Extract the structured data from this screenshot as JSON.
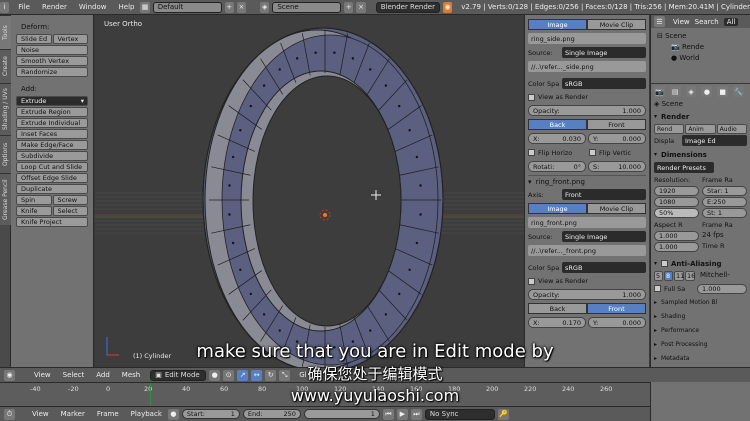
{
  "topbar": {
    "menus": [
      "File",
      "Render",
      "Window",
      "Help"
    ],
    "layout": "Default",
    "scene": "Scene",
    "engine": "Blender Render",
    "stats": "v2.79 | Verts:0/128 | Edges:0/256 | Faces:0/128 | Tris:256 | Mem:20.41M | Cylinder"
  },
  "tabs": [
    "Tools",
    "Create",
    "Shading / UVs",
    "Options",
    "Grease Pencil"
  ],
  "tools": {
    "deform_label": "Deform:",
    "slide_edge": "Slide Ed",
    "vertex": "Vertex",
    "noise": "Noise",
    "smooth_vertex": "Smooth Vertex",
    "randomize": "Randomize",
    "add_label": "Add:",
    "extrude": "Extrude",
    "extrude_region": "Extrude Region",
    "extrude_individual": "Extrude Individual",
    "inset_faces": "Inset Faces",
    "make_edge_face": "Make Edge/Face",
    "subdivide": "Subdivide",
    "loop_cut": "Loop Cut and Slide",
    "offset_edge": "Offset Edge Slide",
    "duplicate": "Duplicate",
    "spin": "Spin",
    "screw": "Screw",
    "knife": "Knife",
    "select": "Select",
    "knife_project": "Knife Project"
  },
  "viewport": {
    "view_label": "User Ortho",
    "object_label": "(1) Cylinder"
  },
  "image_panel": {
    "tab_image": "Image",
    "tab_movie": "Movie Clip",
    "file1": "ring_side.png",
    "source_label": "Source:",
    "source": "Single Image",
    "path1": "//..\\refer..._side.png",
    "color_space_label": "Color Spa",
    "color_space": "sRGB",
    "view_as_render": "View as Render",
    "opacity_label": "Opacity:",
    "opacity": "1.000",
    "back": "Back",
    "front": "Front",
    "x_label": "X:",
    "x_val": "0.030",
    "y_label": "Y:",
    "y_val": "0.000",
    "flip_h": "Flip Horizo",
    "flip_v": "Flip Vertic",
    "rot_label": "Rotati:",
    "rot_val": "0°",
    "size_label": "S:",
    "size_val": "10.000",
    "file2": "ring_front.png",
    "axis_label": "Axis:",
    "axis_val": "Front",
    "path2": "//..\\refer..._front.png",
    "x2_val": "0.170",
    "y2_val": "0.000"
  },
  "outliner": {
    "view": "View",
    "search": "Search",
    "all": "All",
    "items": [
      "Scene",
      "Rende",
      "World"
    ]
  },
  "props": {
    "scene": "Scene",
    "render_head": "Render",
    "render_btns": [
      "Rend",
      "Anim",
      "Audio"
    ],
    "display_label": "Displa",
    "display_val": "Image Ed",
    "dimensions_head": "Dimensions",
    "presets": "Render Presets",
    "res_label": "Resolution:",
    "frame_label": "Frame Ra",
    "res_x": "1920",
    "res_y": "1080",
    "res_pct": "50%",
    "start": "Star: 1",
    "end": "E:250",
    "step": "St: 1",
    "aspect_label": "Aspect R",
    "frame_rate_label": "Frame Ra",
    "aspect_x": "1.000",
    "aspect_y": "1.000",
    "fps": "24 fps",
    "time_label": "Time R",
    "aa_head": "Anti-Aliasing",
    "aa_vals": [
      "5",
      "8",
      "11",
      "16"
    ],
    "aa_filter": "Mitchell-",
    "full_sample": "Full Sa",
    "full_val": "1.000",
    "sampled_mb": "Sampled Motion Bl",
    "sections": [
      "Shading",
      "Performance",
      "Post Processing",
      "Metadata"
    ]
  },
  "vheader": {
    "menus": [
      "View",
      "Select",
      "Add",
      "Mesh"
    ],
    "mode": "Edit Mode",
    "global": "Gl"
  },
  "timeline": {
    "ticks": [
      "-40",
      "-20",
      "0",
      "20",
      "40",
      "60",
      "80",
      "100",
      "120",
      "140",
      "160",
      "180",
      "200",
      "220",
      "240",
      "260"
    ],
    "menus": [
      "View",
      "Marker",
      "Frame",
      "Playback"
    ],
    "start_label": "Start:",
    "start_val": "1",
    "end_label": "End:",
    "end_val": "250",
    "current": "1",
    "sync": "No Sync"
  },
  "subtitles": {
    "english": "make sure that you are in Edit mode by",
    "chinese": "确保您处于编辑模式",
    "watermark": "www.yuyulaoshi.com"
  }
}
